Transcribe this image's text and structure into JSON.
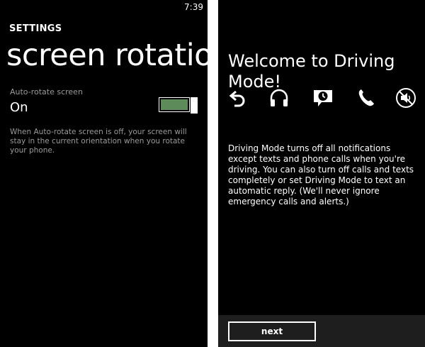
{
  "left_screen": {
    "status_bar": {
      "time": "7:39"
    },
    "section_label": "SETTINGS",
    "page_title": "screen rotation",
    "toggle": {
      "label": "Auto-rotate screen",
      "state_text": "On",
      "is_on": true
    },
    "description": "When Auto-rotate screen is off, your screen will stay in the current orientation when you rotate your phone."
  },
  "right_screen": {
    "title": "Welcome to Driving Mode!",
    "icons": [
      "back-arrow-icon",
      "headphones-icon",
      "auto-reply-message-icon",
      "phone-icon",
      "speaker-muted-icon"
    ],
    "body": "Driving Mode turns off all notifications except texts and phone calls when you're driving. You can also turn off calls and texts completely or set Driving Mode to text an automatic reply. (We'll never ignore emergency calls and alerts.)",
    "next_label": "next"
  },
  "colors": {
    "screen_background": "#000000",
    "divider_background": "#ffffff",
    "secondary_text": "#9a9a9a",
    "toggle_accent": "#5e8b5a",
    "app_bar_background": "#1e1e1e"
  }
}
